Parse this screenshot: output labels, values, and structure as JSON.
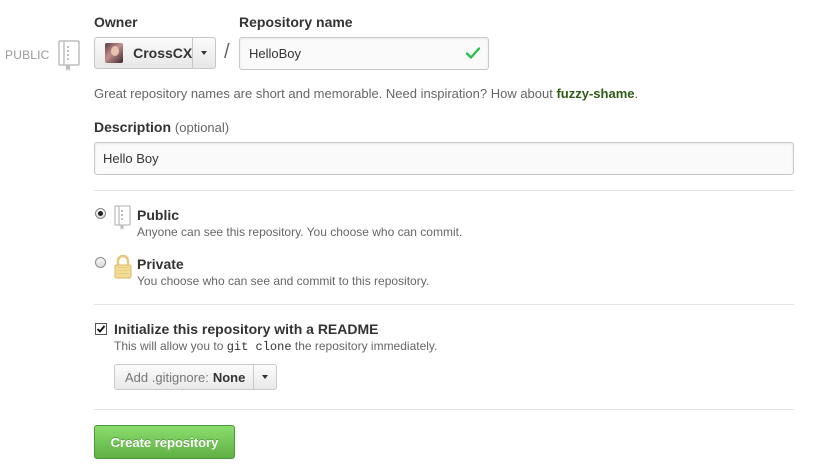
{
  "badge": {
    "label": "PUBLIC"
  },
  "owner": {
    "label": "Owner",
    "name": "CrossCX"
  },
  "separator": "/",
  "repository": {
    "label": "Repository name",
    "value": "HelloBoy"
  },
  "hint": {
    "text": "Great repository names are short and memorable. Need inspiration? How about ",
    "suggestion": "fuzzy-shame",
    "end": "."
  },
  "description": {
    "label": "Description",
    "optional": "(optional)",
    "value": "Hello Boy"
  },
  "visibility": {
    "public": {
      "title": "Public",
      "subtitle": "Anyone can see this repository. You choose who can commit.",
      "checked": true
    },
    "private": {
      "title": "Private",
      "subtitle": "You choose who can see and commit to this repository.",
      "checked": false
    }
  },
  "readme": {
    "title": "Initialize this repository with a README",
    "sub_before": "This will allow you to ",
    "sub_code": "git clone",
    "sub_after": " the repository immediately.",
    "checked": true
  },
  "gitignore": {
    "label": "Add .gitignore:",
    "value": "None"
  },
  "create_button": "Create repository",
  "colors": {
    "accent_green": "#60b044",
    "suggestion_green": "#2f5b15",
    "check_green": "#2cbe4e"
  },
  "icons": [
    "repo-icon",
    "lock-icon",
    "check-icon",
    "chevron-down-icon"
  ]
}
